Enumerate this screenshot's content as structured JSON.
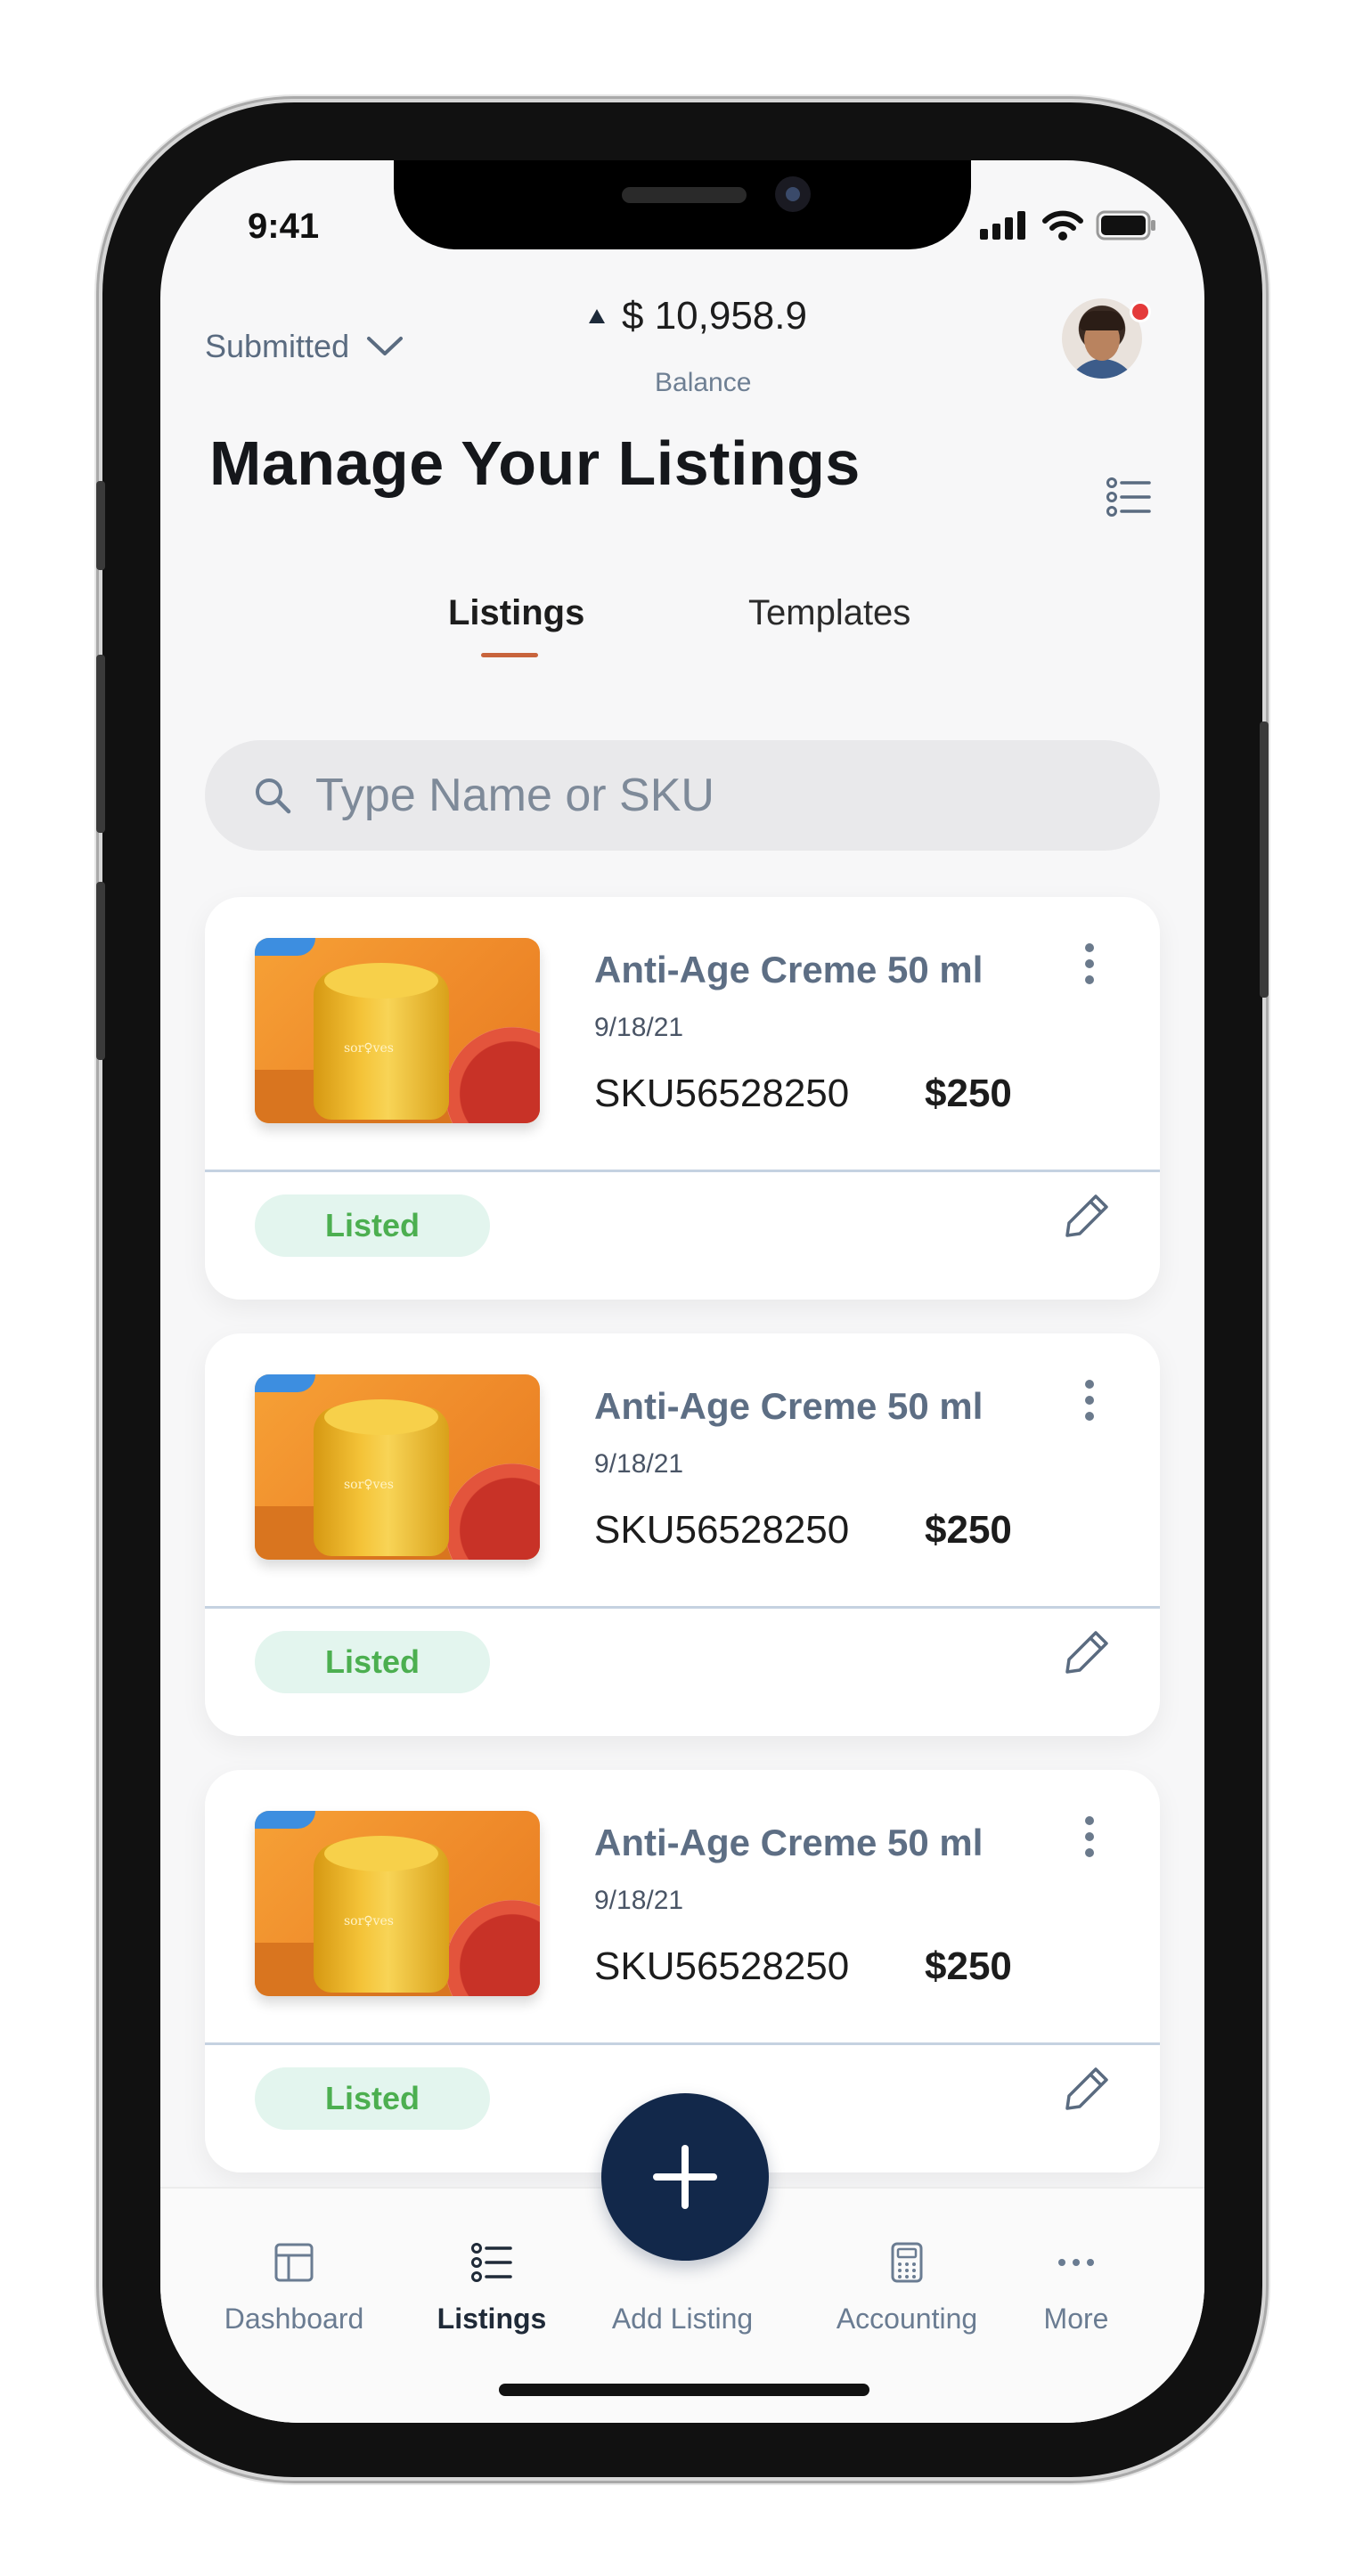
{
  "status_bar": {
    "time": "9:41"
  },
  "header": {
    "filter_label": "Submitted",
    "balance_amount": "$ 10,958.9",
    "balance_caption": "Balance",
    "title": "Manage Your Listings"
  },
  "tabs": [
    {
      "label": "Listings",
      "active": true
    },
    {
      "label": "Templates",
      "active": false
    }
  ],
  "search": {
    "placeholder": "Type Name or SKU",
    "value": ""
  },
  "listings": [
    {
      "title": "Anti-Age Creme 50 ml",
      "date": "9/18/21",
      "sku": "SKU56528250",
      "price": "$250",
      "status": "Listed",
      "image_text": "sor♀ves"
    },
    {
      "title": "Anti-Age Creme 50 ml",
      "date": "9/18/21",
      "sku": "SKU56528250",
      "price": "$250",
      "status": "Listed",
      "image_text": "sor♀ves"
    },
    {
      "title": "Anti-Age Creme 50 ml",
      "date": "9/18/21",
      "sku": "SKU56528250",
      "price": "$250",
      "status": "Listed",
      "image_text": "sor♀ves"
    }
  ],
  "bottom_nav": [
    {
      "label": "Dashboard",
      "icon": "dashboard-icon",
      "active": false
    },
    {
      "label": "Listings",
      "icon": "list-icon",
      "active": true
    },
    {
      "label": "Add Listing",
      "icon": "plus-icon",
      "active": false
    },
    {
      "label": "Accounting",
      "icon": "calculator-icon",
      "active": false
    },
    {
      "label": "More",
      "icon": "more-icon",
      "active": false
    }
  ],
  "colors": {
    "accent_underline": "#c8643c",
    "fab": "#12284a",
    "listed_text": "#4caf50",
    "listed_bg": "#e3f5ee",
    "notification_dot": "#e43a3a"
  }
}
